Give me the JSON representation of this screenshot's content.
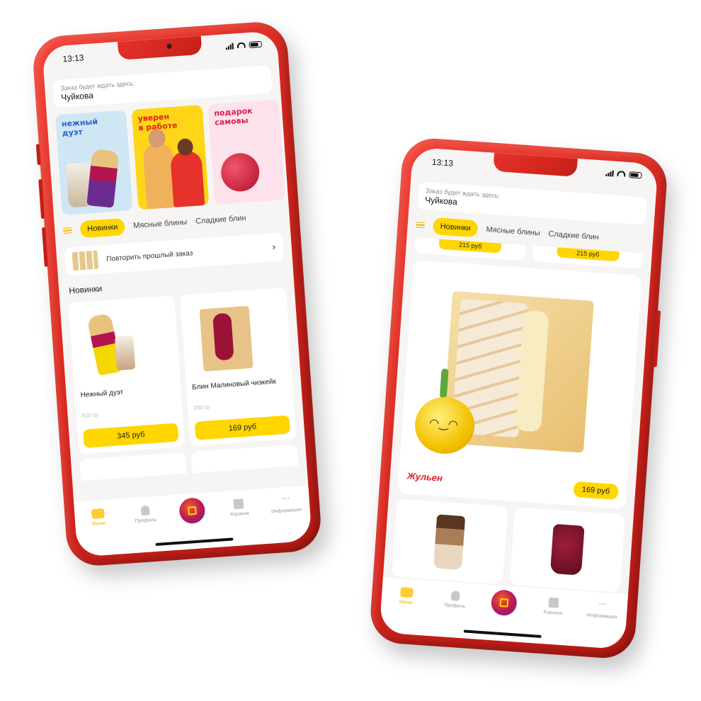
{
  "phone1": {
    "status": {
      "time": "13:13"
    },
    "address": {
      "label": "Заказ будет ждать здесь:",
      "value": "Чуйкова"
    },
    "stories": [
      {
        "title": "нежный\nдуэт"
      },
      {
        "title": "уверен\nв работе"
      },
      {
        "title": "подарок\nсамовы"
      }
    ],
    "tabs": [
      "Новинки",
      "Мясные блины",
      "Сладкие блин"
    ],
    "repeat_order": {
      "label": "Повторить прошлый заказ"
    },
    "section_title": "Новинки",
    "products": [
      {
        "name": "Нежный дуэт",
        "weight": "510 гр",
        "price": "345 руб"
      },
      {
        "name": "Блин Малиновый чизкейк",
        "weight": "200 гр",
        "price": "169 руб"
      }
    ]
  },
  "phone2": {
    "status": {
      "time": "13:13"
    },
    "address": {
      "label": "Заказ будет ждать здесь:",
      "value": "Чуйкова"
    },
    "tabs": [
      "Новинки",
      "Мясные блины",
      "Сладкие блин"
    ],
    "top_prices": [
      "215 руб",
      "215 руб"
    ],
    "featured": {
      "name": "Жульен",
      "price": "169 руб"
    }
  },
  "bottom_nav": [
    "Меню",
    "Профиль",
    "Корзина",
    "Информация"
  ],
  "colors": {
    "frame": "#d8261f",
    "accent": "#ffd600",
    "brand_red": "#e31e24"
  }
}
